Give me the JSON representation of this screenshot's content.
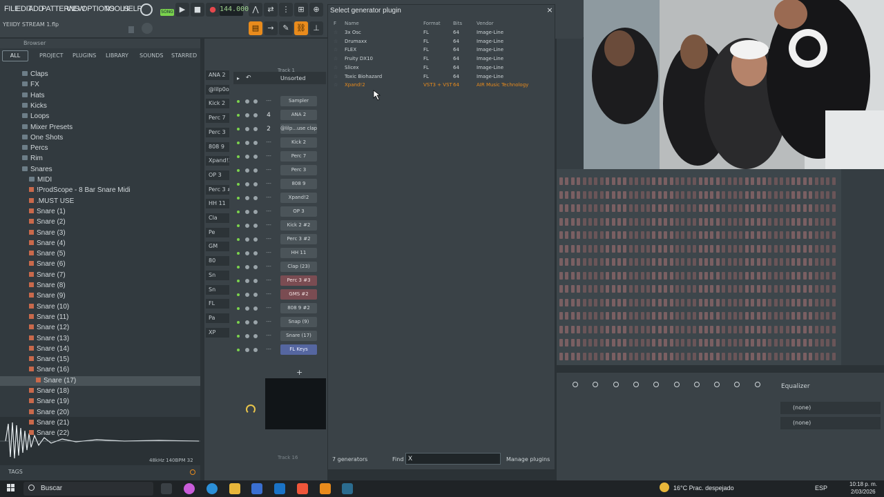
{
  "menu": [
    "FILE",
    "EDIT",
    "ADD",
    "PATTERNS",
    "VIEW",
    "OPTIONS",
    "TOOLS",
    "HELP"
  ],
  "transport": {
    "song_label": "SONG",
    "tempo": "144.000"
  },
  "project": {
    "title": "YEIIDY STREAM 1.flp"
  },
  "browser": {
    "title": "Browser",
    "tabs": [
      "ALL",
      "PROJECT",
      "PLUGINS",
      "LIBRARY",
      "SOUNDS",
      "STARRED"
    ],
    "tree": [
      {
        "label": "Claps",
        "kind": "folder",
        "indent": 1
      },
      {
        "label": "FX",
        "kind": "folder",
        "indent": 1
      },
      {
        "label": "Hats",
        "kind": "folder",
        "indent": 1
      },
      {
        "label": "Kicks",
        "kind": "folder",
        "indent": 1
      },
      {
        "label": "Loops",
        "kind": "folder",
        "indent": 1
      },
      {
        "label": "Mixer Presets",
        "kind": "folder",
        "indent": 1
      },
      {
        "label": "One Shots",
        "kind": "folder",
        "indent": 1
      },
      {
        "label": "Percs",
        "kind": "folder",
        "indent": 1
      },
      {
        "label": "Rim",
        "kind": "folder",
        "indent": 1
      },
      {
        "label": "Snares",
        "kind": "folder",
        "indent": 1
      },
      {
        "label": "MIDI",
        "kind": "folder",
        "indent": 2
      },
      {
        "label": "!ProdScope - 8 Bar Snare Midi",
        "kind": "file",
        "indent": 2
      },
      {
        "label": ".MUST USE",
        "kind": "file",
        "indent": 2
      },
      {
        "label": "Snare  (1)",
        "kind": "file",
        "indent": 2
      },
      {
        "label": "Snare  (2)",
        "kind": "file",
        "indent": 2
      },
      {
        "label": "Snare  (3)",
        "kind": "file",
        "indent": 2
      },
      {
        "label": "Snare  (4)",
        "kind": "file",
        "indent": 2
      },
      {
        "label": "Snare  (5)",
        "kind": "file",
        "indent": 2
      },
      {
        "label": "Snare  (6)",
        "kind": "file",
        "indent": 2
      },
      {
        "label": "Snare  (7)",
        "kind": "file",
        "indent": 2
      },
      {
        "label": "Snare  (8)",
        "kind": "file",
        "indent": 2
      },
      {
        "label": "Snare  (9)",
        "kind": "file",
        "indent": 2
      },
      {
        "label": "Snare  (10)",
        "kind": "file",
        "indent": 2
      },
      {
        "label": "Snare  (11)",
        "kind": "file",
        "indent": 2
      },
      {
        "label": "Snare  (12)",
        "kind": "file",
        "indent": 2
      },
      {
        "label": "Snare  (13)",
        "kind": "file",
        "indent": 2
      },
      {
        "label": "Snare  (14)",
        "kind": "file",
        "indent": 2
      },
      {
        "label": "Snare  (15)",
        "kind": "file",
        "indent": 2
      },
      {
        "label": "Snare  (16)",
        "kind": "file",
        "indent": 2
      },
      {
        "label": "Snare  (17)",
        "kind": "file",
        "indent": 3,
        "selected": true
      },
      {
        "label": "Snare  (18)",
        "kind": "file",
        "indent": 2
      },
      {
        "label": "Snare  (19)",
        "kind": "file",
        "indent": 2
      },
      {
        "label": "Snare  (20)",
        "kind": "file",
        "indent": 2
      },
      {
        "label": "Snare  (21)",
        "kind": "file",
        "indent": 2
      },
      {
        "label": "Snare  (22)",
        "kind": "file",
        "indent": 2
      }
    ],
    "sample_info": "48kHz 140BPM 32",
    "tags_label": "TAGS"
  },
  "rack": {
    "group": "Unsorted",
    "left_labels": [
      "ANA 2",
      "@lilp0o",
      "Kick 2",
      "Perc 7",
      "Perc 3",
      "808 9",
      "Xpand!2",
      "OP 3",
      "Perc 3 #",
      "HH 11",
      "Cla",
      "Pe",
      "GM",
      "80",
      "Sn",
      "Sn",
      "FL",
      "Pa",
      "XP"
    ],
    "channels": [
      {
        "label": "Sampler",
        "style": "normal",
        "num": ""
      },
      {
        "label": "ANA 2",
        "style": "normal",
        "num": "4"
      },
      {
        "label": "@lilp...use clap",
        "style": "normal",
        "num": "2"
      },
      {
        "label": "Kick 2",
        "style": "normal",
        "num": ""
      },
      {
        "label": "Perc 7",
        "style": "normal",
        "num": ""
      },
      {
        "label": "Perc 3",
        "style": "normal",
        "num": ""
      },
      {
        "label": "808 9",
        "style": "normal",
        "num": ""
      },
      {
        "label": "Xpand!2",
        "style": "normal",
        "num": ""
      },
      {
        "label": "OP 3",
        "style": "normal",
        "num": ""
      },
      {
        "label": "Kick 2 #2",
        "style": "normal",
        "num": ""
      },
      {
        "label": "Perc 3 #2",
        "style": "normal",
        "num": ""
      },
      {
        "label": "HH 11",
        "style": "normal",
        "num": ""
      },
      {
        "label": "Clap  (23)",
        "style": "normal",
        "num": ""
      },
      {
        "label": "Perc 3 #3",
        "style": "red",
        "num": ""
      },
      {
        "label": "GMS #2",
        "style": "red",
        "num": ""
      },
      {
        "label": "808 9 #2",
        "style": "normal",
        "num": ""
      },
      {
        "label": "Snap  (9)",
        "style": "normal",
        "num": ""
      },
      {
        "label": "Snare  (17)",
        "style": "normal",
        "num": ""
      },
      {
        "label": "FL Keys",
        "style": "blue",
        "num": ""
      }
    ],
    "track_top": "Track 1",
    "track_bottom": "Track 16",
    "add_label": "+"
  },
  "dialog": {
    "title": "Select generator plugin",
    "close": "×",
    "columns": {
      "flag": "F",
      "name": "Name",
      "format": "Format",
      "bits": "Bits",
      "vendor": "Vendor"
    },
    "plugins": [
      {
        "name": "3x Osc",
        "format": "FL",
        "bits": "64",
        "vendor": "Image-Line",
        "highlight": false
      },
      {
        "name": "Drumaxx",
        "format": "FL",
        "bits": "64",
        "vendor": "Image-Line",
        "highlight": false
      },
      {
        "name": "FLEX",
        "format": "FL",
        "bits": "64",
        "vendor": "Image-Line",
        "highlight": false
      },
      {
        "name": "Fruity DX10",
        "format": "FL",
        "bits": "64",
        "vendor": "Image-Line",
        "highlight": false
      },
      {
        "name": "Slicex",
        "format": "FL",
        "bits": "64",
        "vendor": "Image-Line",
        "highlight": false
      },
      {
        "name": "Toxic Biohazard",
        "format": "FL",
        "bits": "64",
        "vendor": "Image-Line",
        "highlight": false
      },
      {
        "name": "Xpand!2",
        "format": "VST3 + VST",
        "bits": "64",
        "vendor": "AIR Music Technology",
        "highlight": true
      }
    ],
    "footer": {
      "count": "7 generators",
      "find_label": "Find",
      "find_value": "X",
      "manage": "Manage plugins"
    }
  },
  "mixer": {
    "effect_label": "Equalizer",
    "slots": [
      "(none)",
      "(none)"
    ]
  },
  "taskbar": {
    "search": "Buscar",
    "weather": "16°C  Prac. despejado",
    "lang": "ESP",
    "time": "10:18 p. m.",
    "date": "2/03/2026"
  },
  "colors": {
    "accent": "#e98b1c",
    "led": "#7bd34d",
    "highlight_channel": "#7a4c52",
    "selected_channel": "#5566a0"
  }
}
